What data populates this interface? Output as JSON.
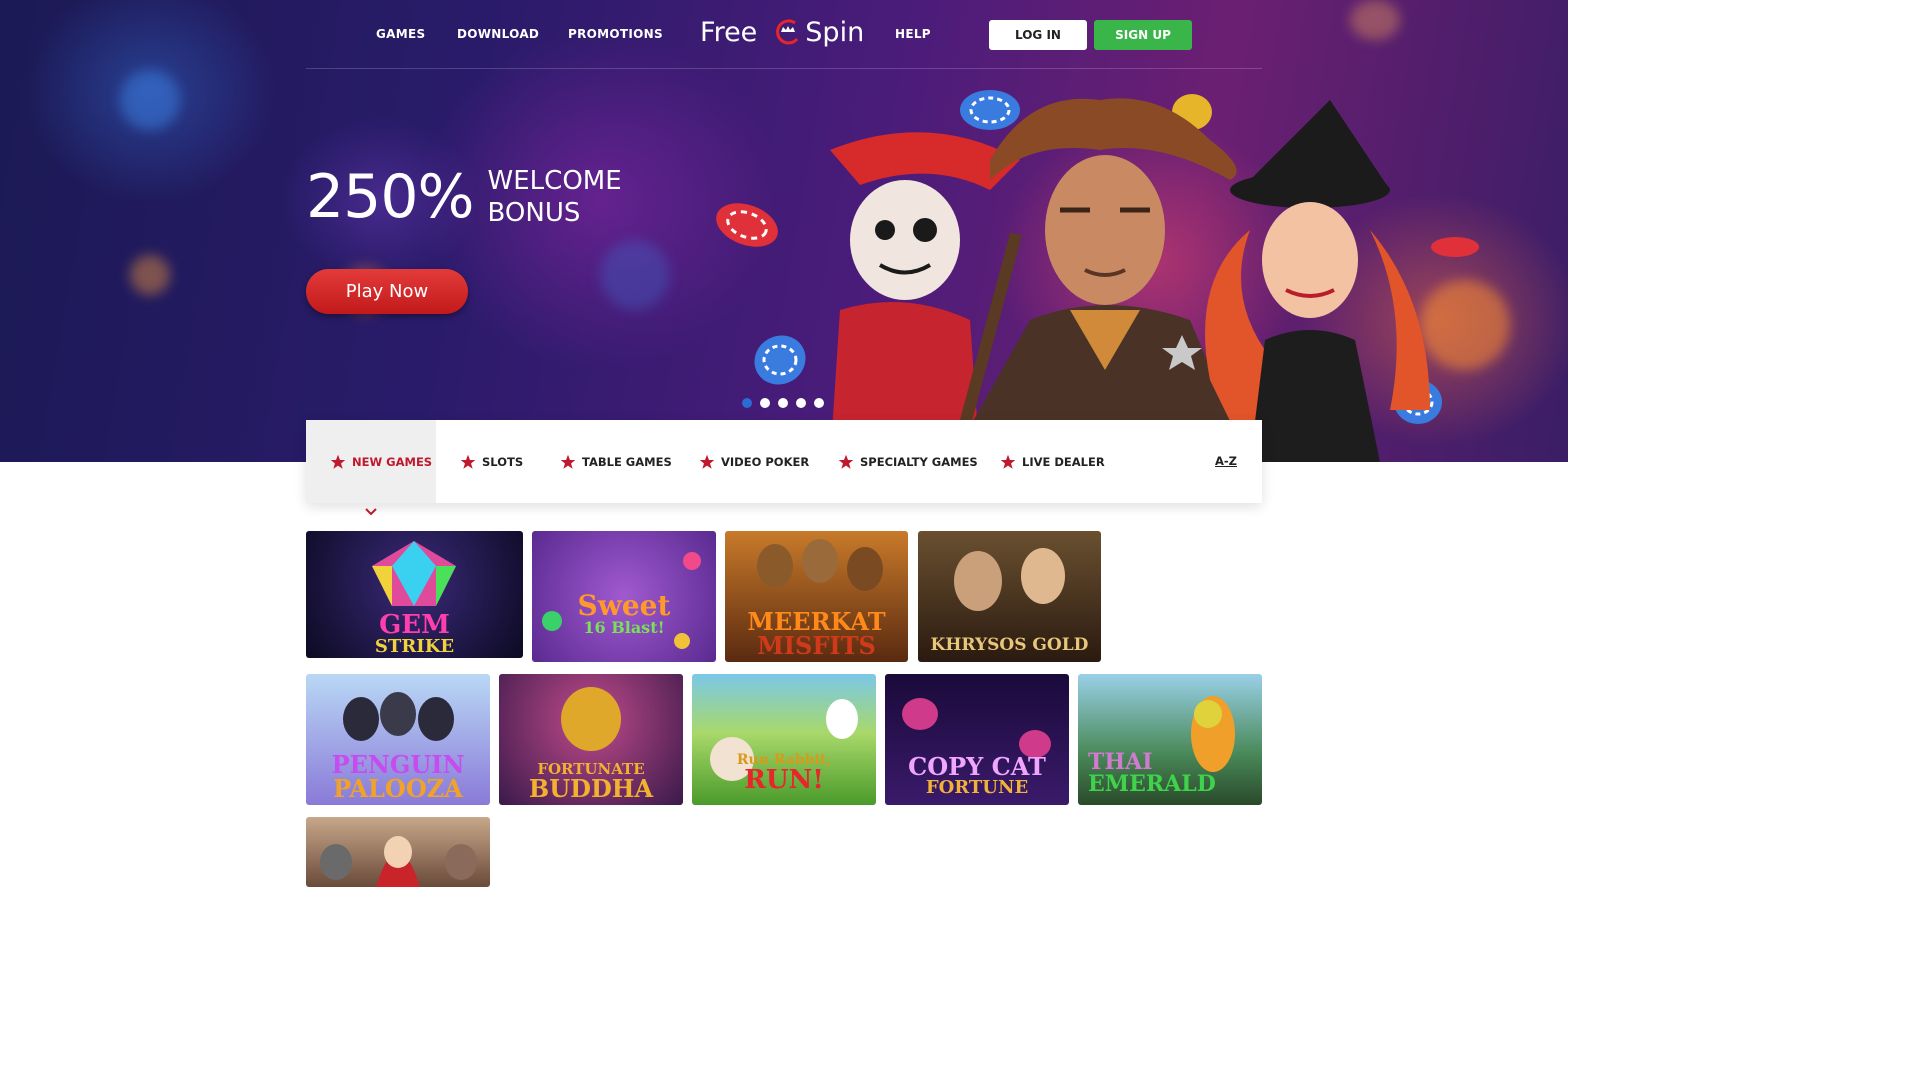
{
  "nav": {
    "games": "GAMES",
    "download": "DOWNLOAD",
    "promotions": "PROMOTIONS",
    "help": "HELP",
    "login": "LOG IN",
    "signup": "SIGN UP"
  },
  "logo": {
    "left": "Free",
    "right": "Spin"
  },
  "hero": {
    "bonus_number": "250%",
    "bonus_line1": "WELCOME",
    "bonus_line2": "BONUS",
    "cta": "Play Now",
    "slides_total": 5,
    "active_slide": 1
  },
  "categories": {
    "items": [
      "NEW GAMES",
      "SLOTS",
      "TABLE GAMES",
      "VIDEO POKER",
      "SPECIALTY GAMES",
      "LIVE DEALER"
    ],
    "active": "NEW GAMES",
    "az": "A-Z"
  },
  "games": [
    {
      "title_line1": "GEM",
      "title_line2": "STRIKE",
      "color": "#ff3fae"
    },
    {
      "title_line1": "Sweet",
      "title_line2": "16 Blast!",
      "color": "#ff9a2a"
    },
    {
      "title_line1": "MEERKAT",
      "title_line2": "MISFITS",
      "color": "#ff8a1a"
    },
    {
      "title_line1": "KHRYSOS GOLD",
      "title_line2": "",
      "color": "#e8c67a"
    },
    {
      "title_line1": "PENGUIN",
      "title_line2": "PALOOZA",
      "color": "#c64cf0"
    },
    {
      "title_line1": "FORTUNATE",
      "title_line2": "BUDDHA",
      "color": "#f2b230"
    },
    {
      "title_line1": "Run Rabbit,",
      "title_line2": "RUN!",
      "color": "#e8242c"
    },
    {
      "title_line1": "COPY CAT",
      "title_line2": "FORTUNE",
      "color": "#f0a6ff"
    },
    {
      "title_line1": "THAI",
      "title_line2": "EMERALD",
      "color": "#3fd24a"
    }
  ],
  "colors": {
    "accent_red": "#c0182c",
    "signup_green": "#3ab54a",
    "hero_indigo": "#2a1b6a"
  }
}
